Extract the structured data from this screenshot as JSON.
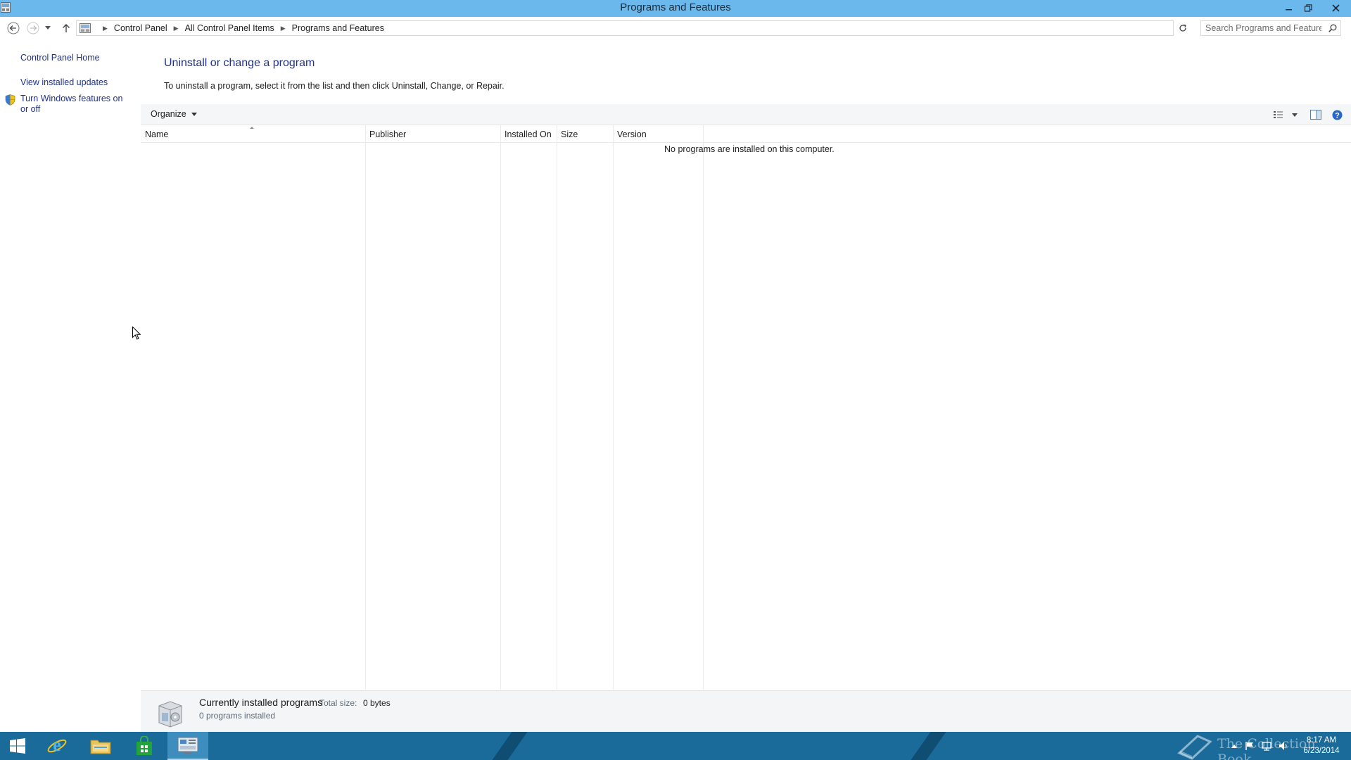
{
  "window": {
    "title": "Programs and Features"
  },
  "address_bar": {
    "breadcrumbs": [
      "Control Panel",
      "All Control Panel Items",
      "Programs and Features"
    ],
    "search_placeholder": "Search Programs and Features"
  },
  "sidebar": {
    "links": [
      {
        "label": "Control Panel Home",
        "icon": null
      },
      {
        "label": "View installed updates",
        "icon": null
      },
      {
        "label": "Turn Windows features on or off",
        "icon": "shield-icon"
      }
    ]
  },
  "main": {
    "heading": "Uninstall or change a program",
    "description": "To uninstall a program, select it from the list and then click Uninstall, Change, or Repair.",
    "toolbar": {
      "organize_label": "Organize"
    },
    "columns": [
      "Name",
      "Publisher",
      "Installed On",
      "Size",
      "Version"
    ],
    "rows": [],
    "empty_message": "No programs are installed on this computer."
  },
  "details": {
    "title": "Currently installed programs",
    "total_size_label": "Total size:",
    "total_size_value": "0 bytes",
    "count_text": "0 programs installed"
  },
  "taskbar": {
    "apps": [
      {
        "name": "start-button",
        "icon": "windows-logo-icon"
      },
      {
        "name": "internet-explorer",
        "icon": "ie-icon"
      },
      {
        "name": "file-explorer",
        "icon": "folder-icon"
      },
      {
        "name": "store",
        "icon": "store-icon"
      },
      {
        "name": "control-panel",
        "icon": "control-panel-icon",
        "active": true
      }
    ],
    "watermark": "The Collection Book",
    "clock": {
      "time": "8:17 AM",
      "date": "6/23/2014"
    }
  },
  "colors": {
    "titlebar": "#6ab8ec",
    "link": "#1e3287",
    "taskbar": "#1a6b9a",
    "close_button": "#c7383f"
  }
}
